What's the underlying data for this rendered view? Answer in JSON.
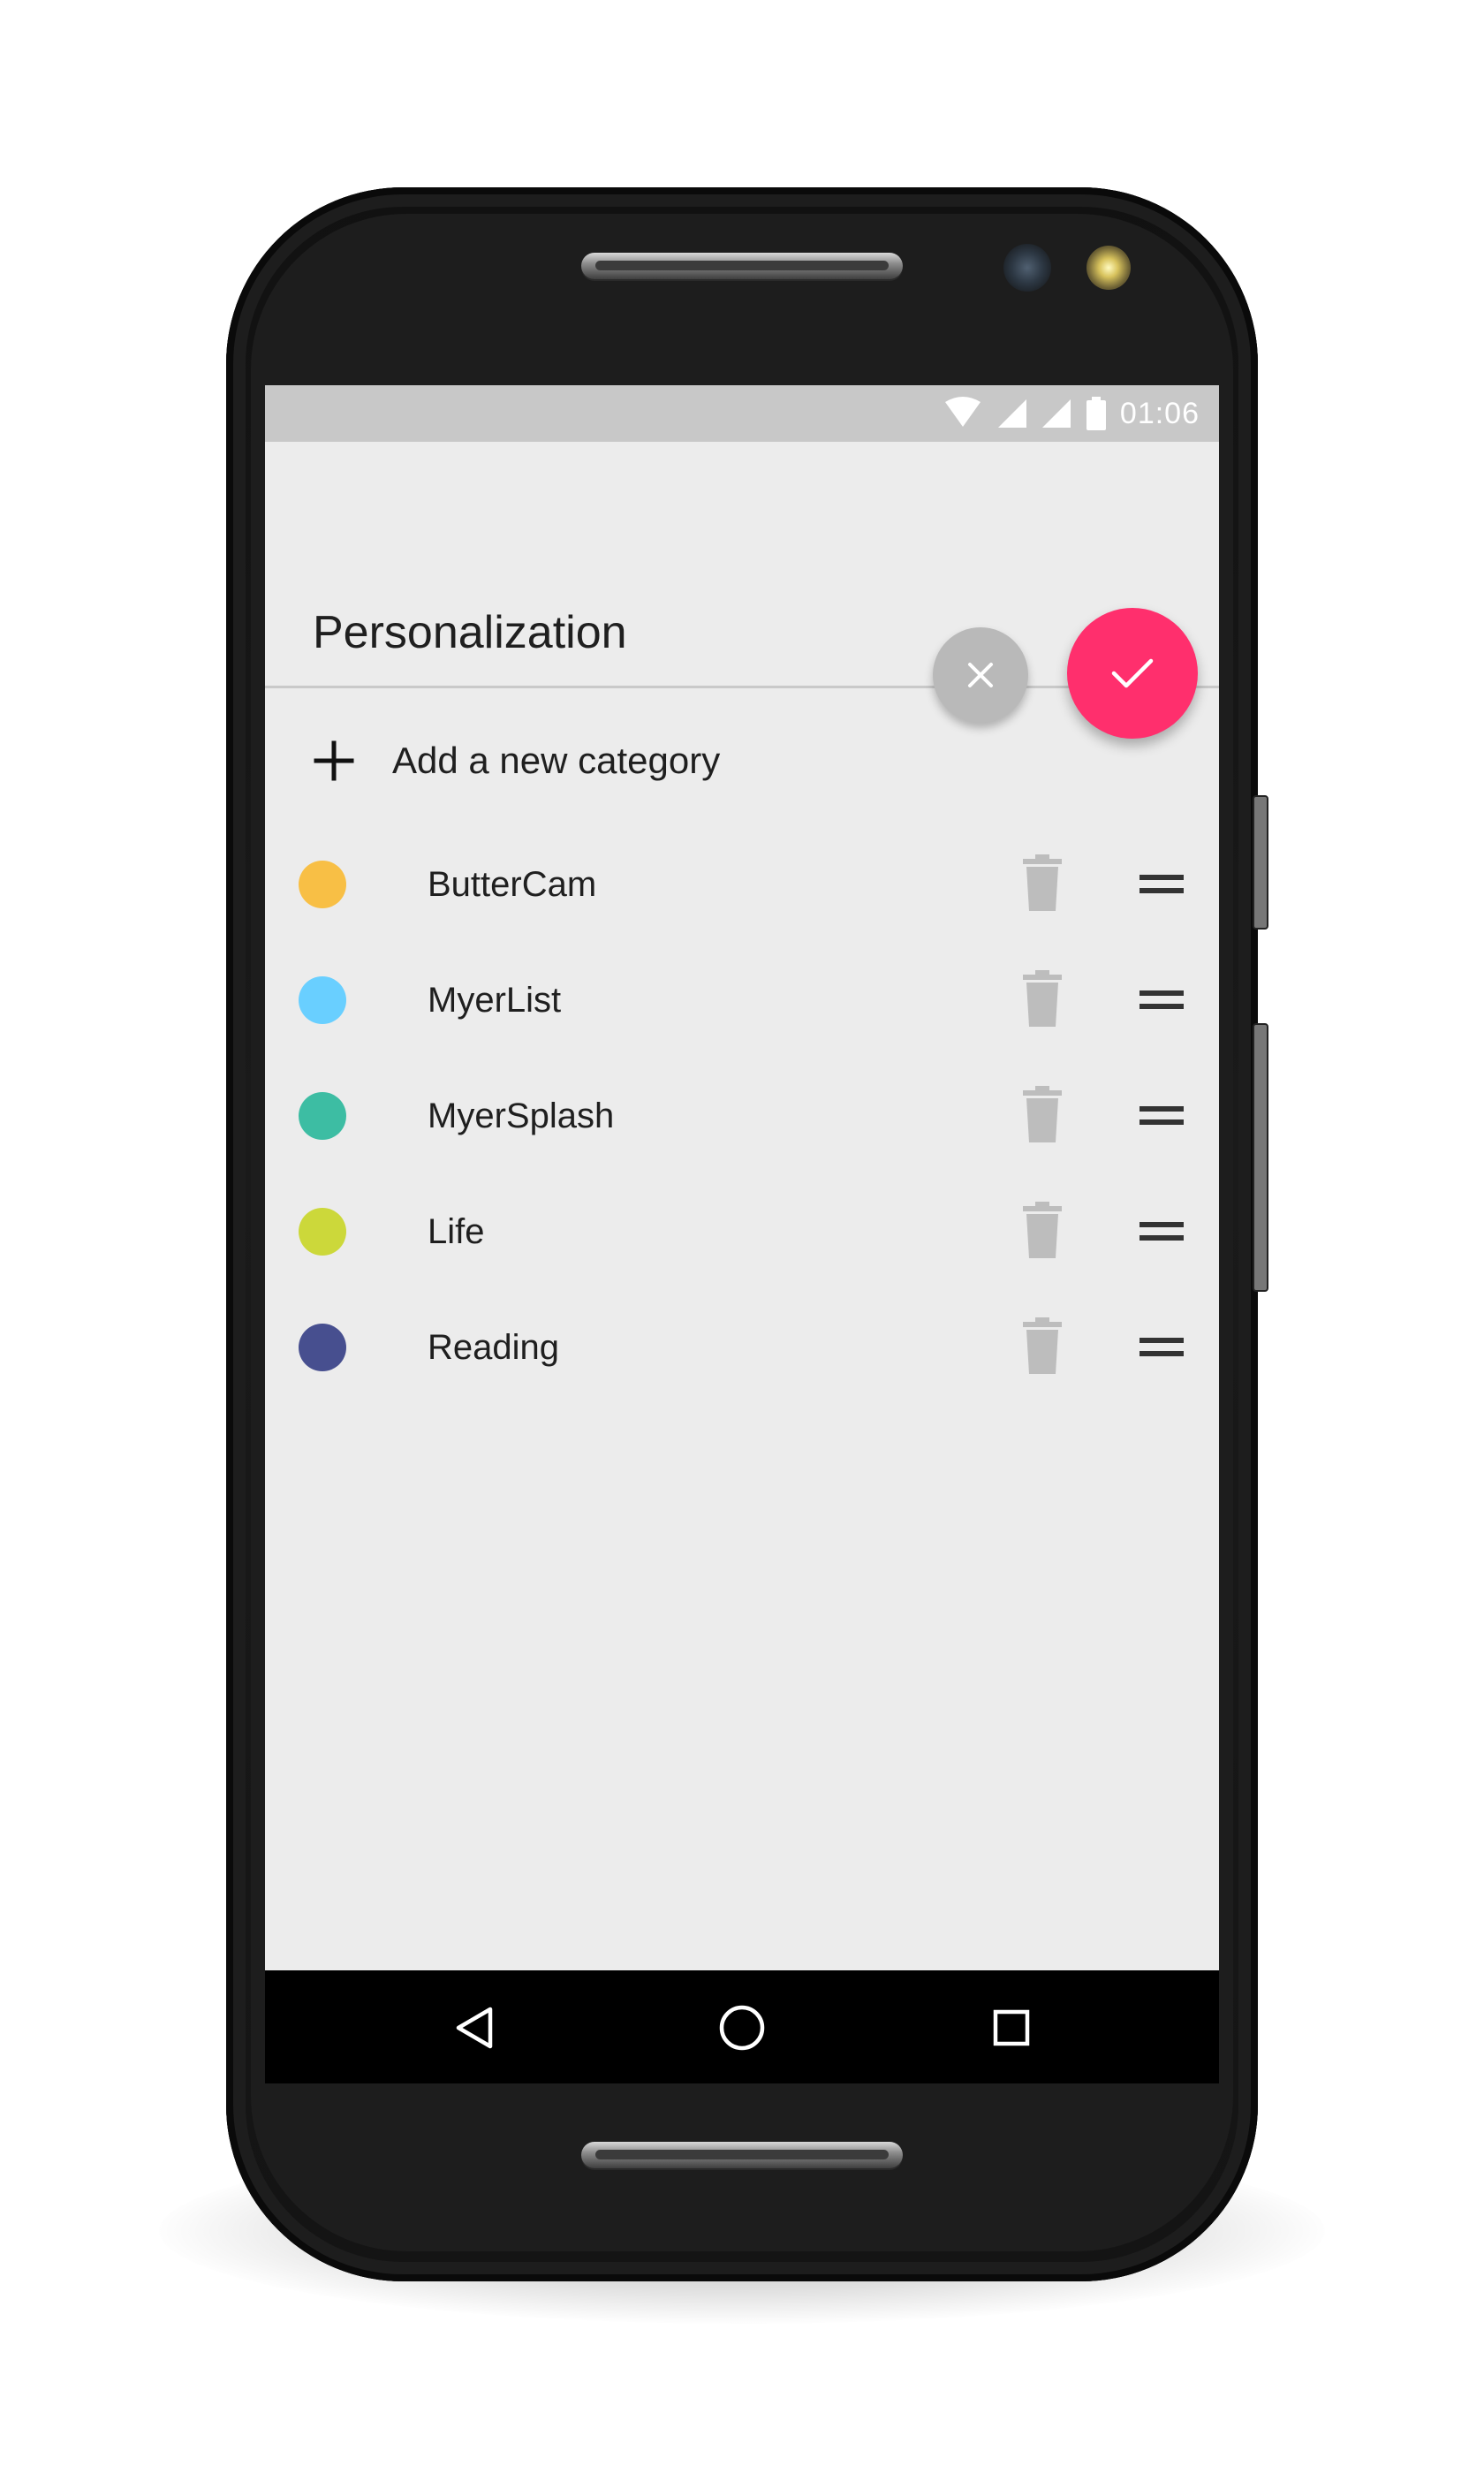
{
  "status_bar": {
    "time": "01:06",
    "icons": [
      "wifi-icon",
      "signal-icon",
      "signal-icon",
      "battery-icon"
    ]
  },
  "header": {
    "title": "Personalization"
  },
  "actions": {
    "cancel_icon": "close-icon",
    "confirm_icon": "check-icon",
    "confirm_color": "#ff2f6d",
    "cancel_color": "#b9b9b9"
  },
  "add_category": {
    "label": "Add a new category",
    "icon": "plus-icon"
  },
  "categories": [
    {
      "label": "ButterCam",
      "color": "#f8bf45"
    },
    {
      "label": "MyerList",
      "color": "#69cfff"
    },
    {
      "label": "MyerSplash",
      "color": "#3dbda3"
    },
    {
      "label": "Life",
      "color": "#ccd83a"
    },
    {
      "label": "Reading",
      "color": "#474f8f"
    }
  ],
  "row_icons": {
    "delete_icon": "trash-icon",
    "drag_icon": "drag-handle-icon"
  },
  "navigation": {
    "back_icon": "back-icon",
    "home_icon": "home-icon",
    "recents_icon": "recents-icon"
  }
}
